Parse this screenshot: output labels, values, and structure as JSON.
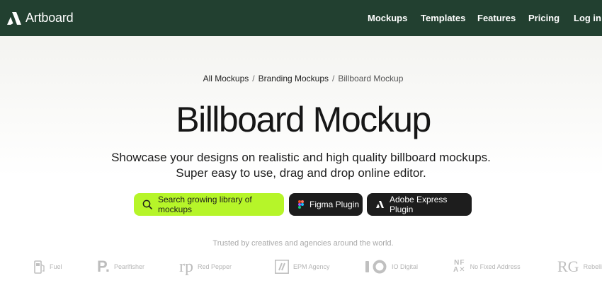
{
  "header": {
    "brand": "Artboard",
    "nav": [
      "Mockups",
      "Templates",
      "Features",
      "Pricing",
      "Log in"
    ]
  },
  "breadcrumb": {
    "items": [
      "All Mockups",
      "Branding Mockups"
    ],
    "separator": "/",
    "current": "Billboard Mockup"
  },
  "hero": {
    "title": "Billboard Mockup",
    "subtitle_line1": "Showcase your designs on realistic and high quality billboard mockups.",
    "subtitle_line2": "Super easy to use, drag and drop online editor."
  },
  "actions": {
    "search_label": "Search growing library of mockups",
    "figma_label": "Figma Plugin",
    "adobe_label": "Adobe Express Plugin"
  },
  "trusted": {
    "text": "Trusted by creatives and agencies around the world.",
    "logos": [
      "Fuel",
      "Pearlfisher",
      "Red Pepper",
      "EPM Agency",
      "IO Digital",
      "No Fixed Address",
      "Rebellion"
    ],
    "marks": {
      "pearlfisher": "P.",
      "red_pepper": "rp",
      "nfa_top": "NF",
      "nfa_bottom": "A✕",
      "rebellion": "RG"
    }
  },
  "colors": {
    "header_bg": "#224030",
    "search_accent": "#b6f529",
    "dark_button": "#1d1d1d"
  },
  "icons": [
    "artboard-logo-icon",
    "search-icon",
    "figma-icon",
    "adobe-express-icon",
    "fuel-pump-icon",
    "epm-slash-icon",
    "io-digital-icon"
  ]
}
